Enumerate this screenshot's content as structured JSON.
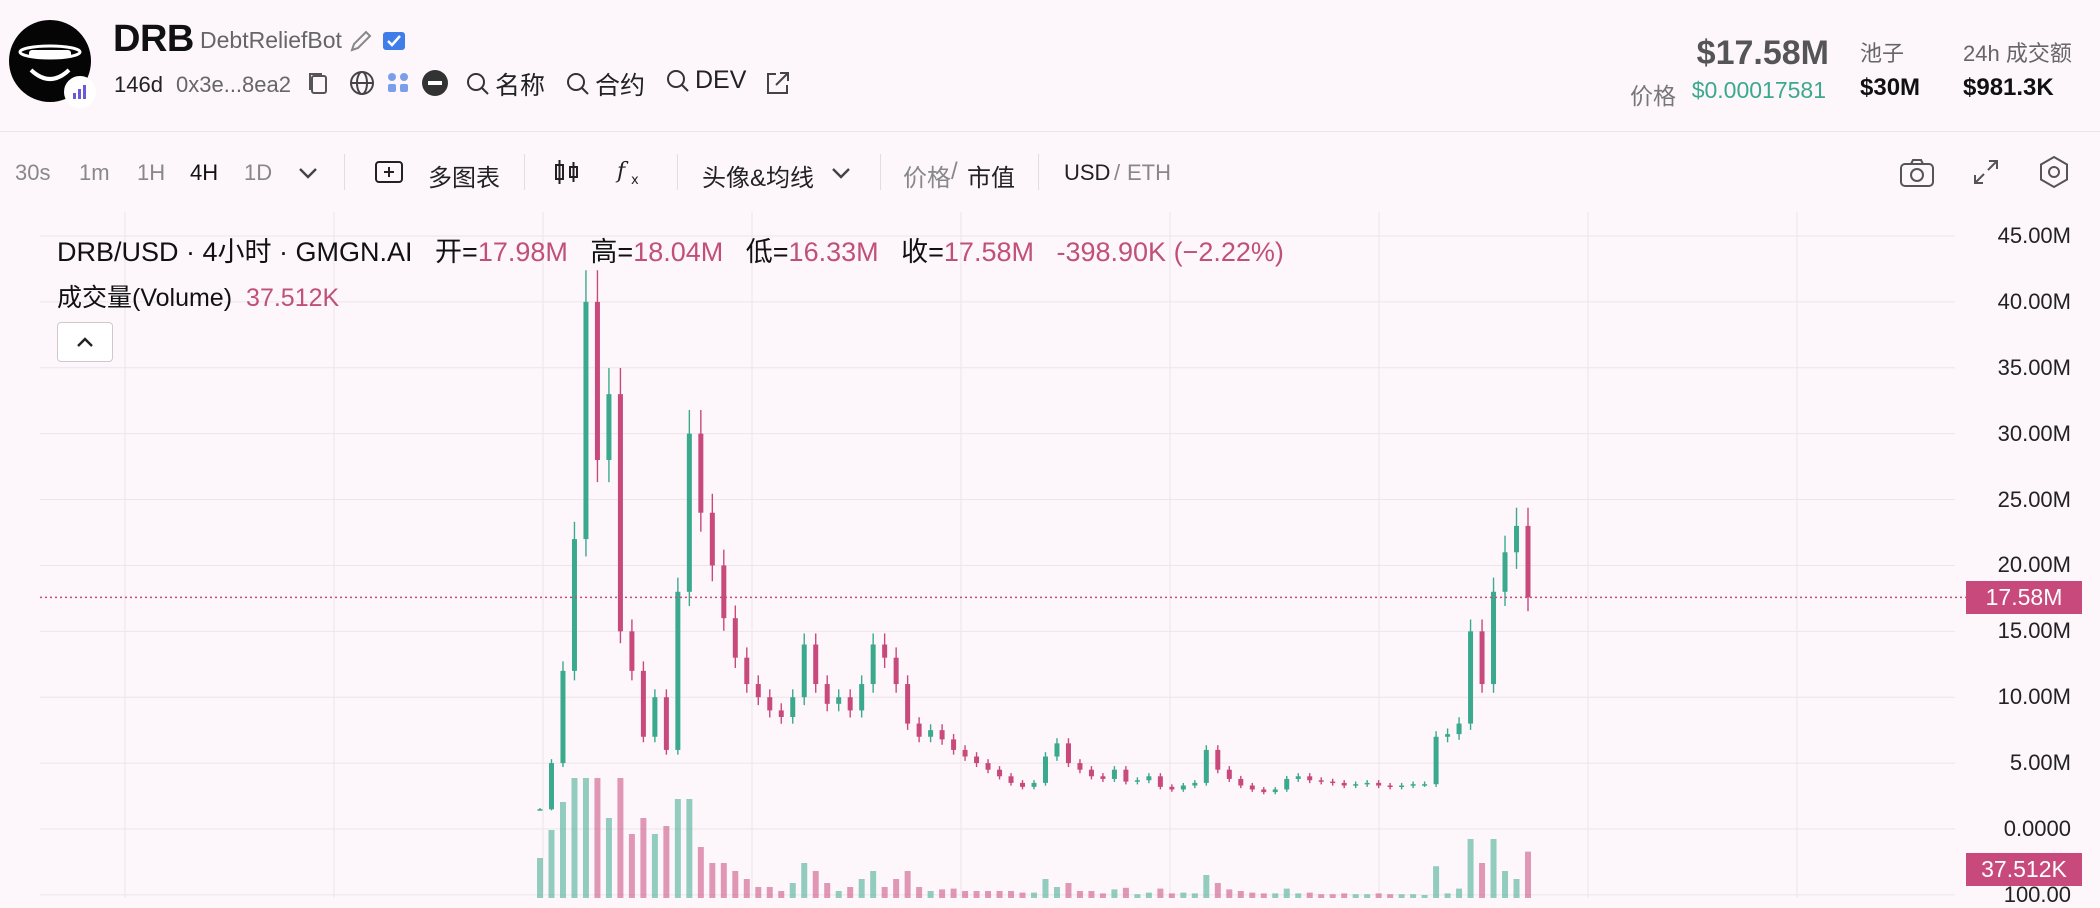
{
  "token": {
    "symbol": "DRB",
    "name": "DebtReliefBot",
    "age": "146d",
    "address": "0x3e...8ea2",
    "market_cap": "$17.58M",
    "price_label": "价格",
    "price": "$0.00017581",
    "pool_label": "池子",
    "pool": "$30M",
    "volume_label": "24h 成交额",
    "volume": "$981.3K"
  },
  "links": {
    "name_search": "名称",
    "contract_search": "合约",
    "dev_search": "DEV"
  },
  "icons": [
    "edit-icon",
    "verified-icon",
    "copy-icon",
    "globe-icon",
    "community-icon",
    "minus-circle-icon",
    "search-icon",
    "external-link-icon",
    "multi-chart-icon",
    "candle-type-icon",
    "function-icon",
    "chevron-down-icon",
    "camera-icon",
    "fullscreen-icon",
    "settings-icon",
    "chevron-up-icon"
  ],
  "toolbar": {
    "timeframes": [
      "30s",
      "1m",
      "1H",
      "4H",
      "1D"
    ],
    "active_timeframe": "4H",
    "multi_chart": "多图表",
    "avatar_ma": "头像&均线",
    "price_toggle": "价格",
    "mcap_toggle": "市值",
    "sep": "/",
    "usd": "USD",
    "eth": "ETH"
  },
  "colors": {
    "up": "#3aa98e",
    "down": "#c8497b",
    "price_green": "#3aa98e",
    "accent_pink": "#c8497b"
  },
  "chart_data": {
    "type": "line",
    "title": "DRB/USD · 4小时 · GMGN.AI",
    "ohlc": {
      "open_label": "开=",
      "open": "17.98M",
      "high_label": "高=",
      "high": "18.04M",
      "low_label": "低=",
      "low": "16.33M",
      "close_label": "收=",
      "close": "17.58M",
      "change": "-398.90K (−2.22%)"
    },
    "volume_label": "成交量(Volume)",
    "volume_value": "37.512K",
    "last_price": "17.58M",
    "y_ticks": [
      "45.00M",
      "40.00M",
      "35.00M",
      "30.00M",
      "25.00M",
      "20.00M",
      "15.00M",
      "10.00M",
      "5.00M",
      "0.0000",
      "100.00"
    ],
    "ylim": [
      0,
      45
    ],
    "y_unit": "M",
    "series": [
      {
        "values": [
          1.5,
          5,
          12,
          22,
          40,
          28,
          33,
          15,
          12,
          7,
          10,
          6,
          18,
          30,
          24,
          20,
          16,
          13,
          11,
          10,
          9,
          8.5,
          10,
          14,
          11,
          9.5,
          10,
          9,
          11,
          14,
          13,
          11,
          8,
          7,
          7.5,
          6.8,
          6,
          5.5,
          5,
          4.5,
          4,
          3.5,
          3.2,
          3.5,
          5.5,
          6.5,
          5,
          4.5,
          4,
          3.8,
          4.5,
          3.6,
          3.7,
          4,
          3.2,
          3,
          3.3,
          3.5,
          6,
          4.5,
          3.8,
          3.3,
          3,
          2.8,
          3,
          3.8,
          4,
          3.7,
          3.6,
          3.5,
          3.3,
          3.4,
          3.5,
          3.3,
          3.2,
          3.3,
          3.4,
          3.4,
          7,
          7.2,
          8,
          15,
          11,
          18,
          21,
          23,
          17.58
        ]
      }
    ]
  }
}
